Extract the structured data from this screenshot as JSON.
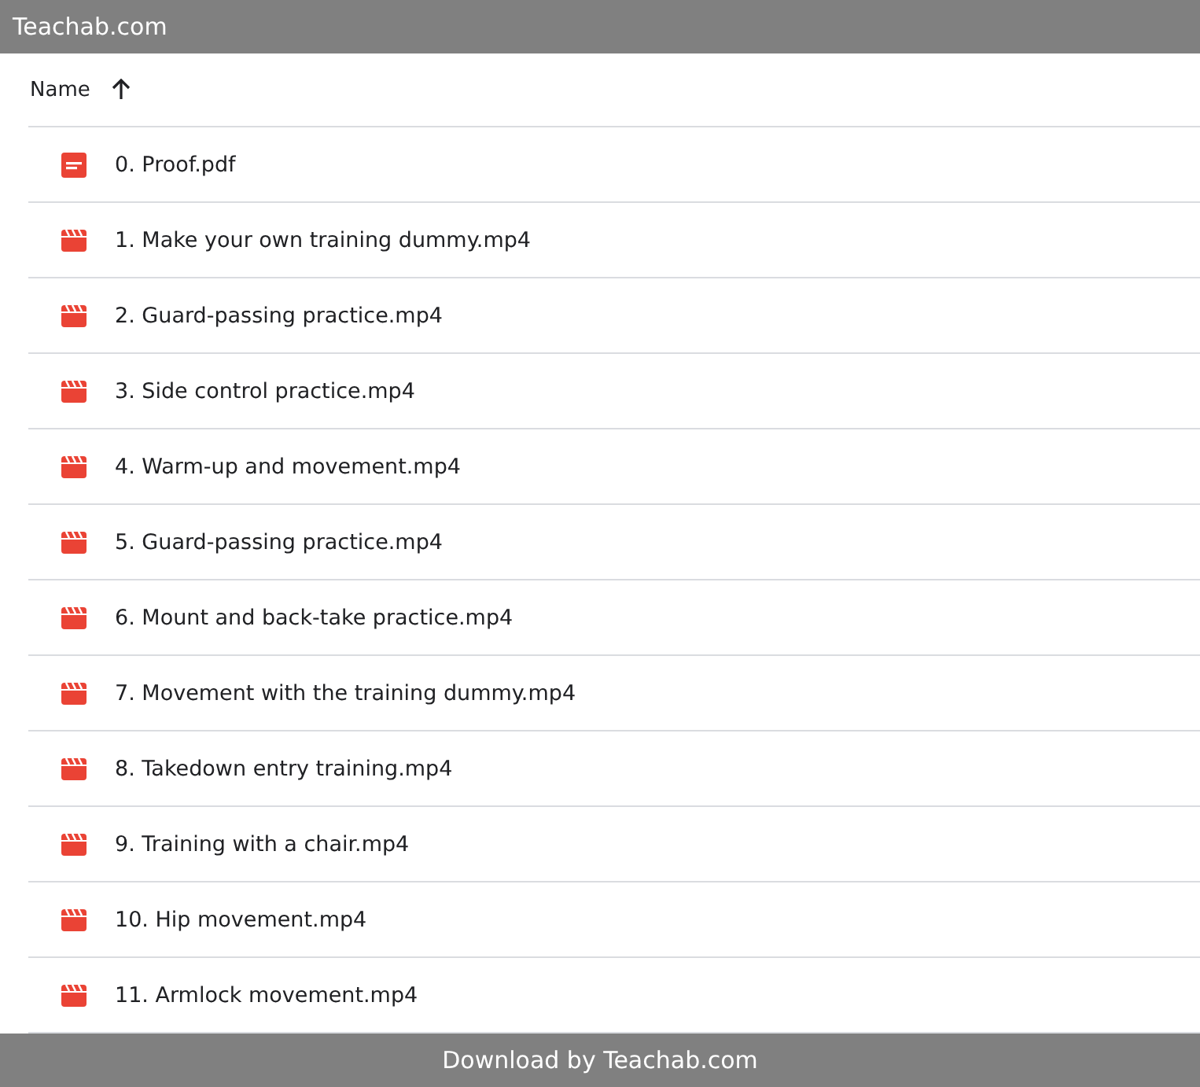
{
  "header": {
    "title": "Teachab.com"
  },
  "table": {
    "columns": [
      {
        "label": "Name",
        "sorted_ascending": true
      }
    ],
    "rows": [
      {
        "kind": "pdf",
        "name": "0. Proof.pdf"
      },
      {
        "kind": "video",
        "name": "1. Make your own training dummy.mp4"
      },
      {
        "kind": "video",
        "name": "2. Guard-passing practice.mp4"
      },
      {
        "kind": "video",
        "name": "3. Side control practice.mp4"
      },
      {
        "kind": "video",
        "name": "4. Warm-up and movement.mp4"
      },
      {
        "kind": "video",
        "name": "5. Guard-passing practice.mp4"
      },
      {
        "kind": "video",
        "name": "6. Mount and back-take practice.mp4"
      },
      {
        "kind": "video",
        "name": "7. Movement with the training dummy.mp4"
      },
      {
        "kind": "video",
        "name": "8. Takedown entry training.mp4"
      },
      {
        "kind": "video",
        "name": "9. Training with a chair.mp4"
      },
      {
        "kind": "video",
        "name": "10. Hip movement.mp4"
      },
      {
        "kind": "video",
        "name": "11. Armlock movement.mp4"
      }
    ]
  },
  "footer": {
    "text": "Download by Teachab.com"
  }
}
